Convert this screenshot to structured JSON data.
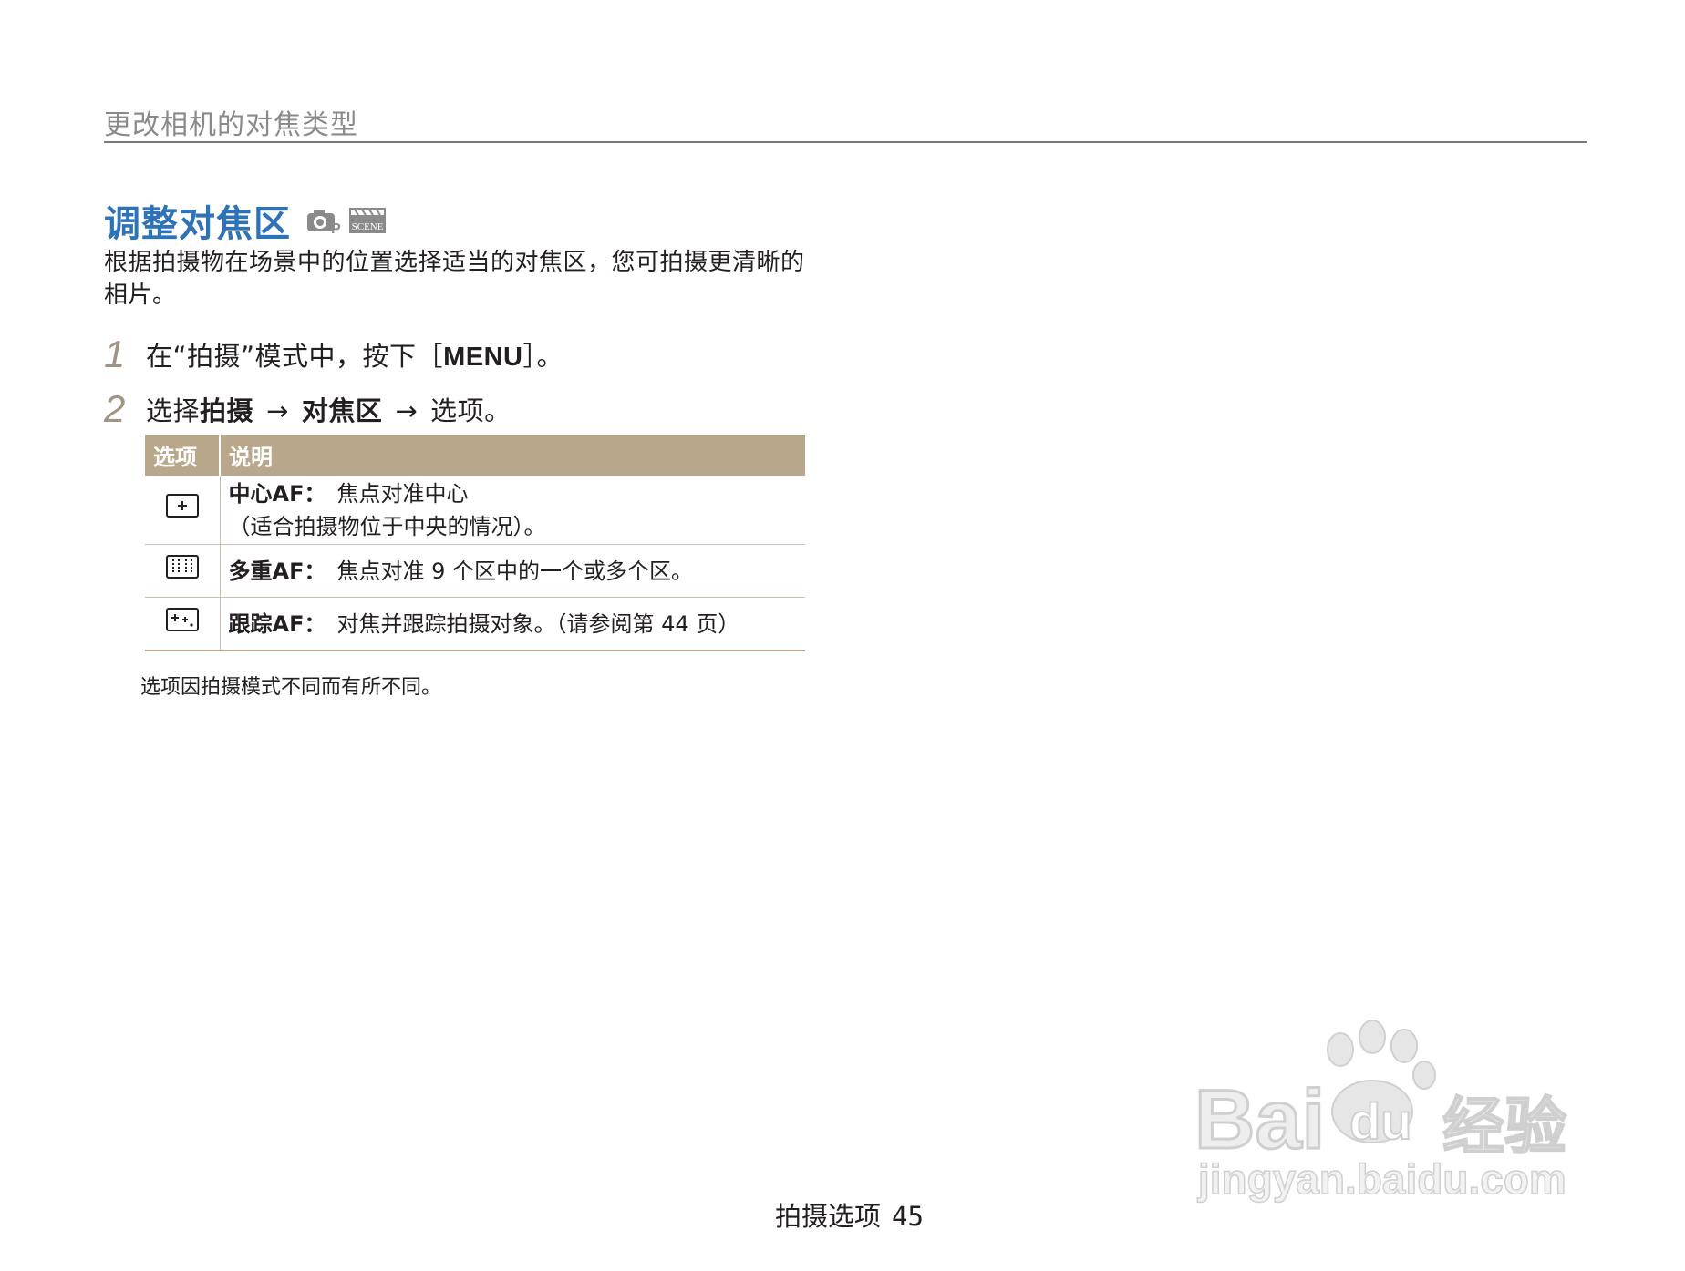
{
  "header": {
    "title": "更改相机的对焦类型"
  },
  "section": {
    "title": "调整对焦区",
    "mode_icons": [
      "camera-program-icon",
      "scene-mode-icon"
    ],
    "scene_icon_text": "SCENE",
    "program_icon_text": "P",
    "intro": "根据拍摄物在场景中的位置选择适当的对焦区，您可拍摄更清晰的相片。"
  },
  "steps": [
    {
      "number": "1",
      "text_before": "在“拍摄”模式中，按下［",
      "key": "MENU",
      "text_after": "］。"
    },
    {
      "number": "2",
      "prefix": "选择",
      "item1": "拍摄",
      "arrow1": "→",
      "item2": "对焦区",
      "arrow2": "→",
      "suffix": "选项。"
    }
  ],
  "table": {
    "headers": [
      "选项",
      "说明"
    ],
    "rows": [
      {
        "icon": "center-af-icon",
        "name": "中心AF：",
        "desc": "焦点对准中心",
        "desc2": "（适合拍摄物位于中央的情况）。"
      },
      {
        "icon": "multi-af-icon",
        "name": "多重AF：",
        "desc": "焦点对准 9 个区中的一个或多个区。"
      },
      {
        "icon": "tracking-af-icon",
        "name": "跟踪AF：",
        "desc": "对焦并跟踪拍摄对象。（请参阅第 44 页）"
      }
    ]
  },
  "note": "选项因拍摄模式不同而有所不同。",
  "footer": {
    "label": "拍摄选项",
    "page": "45"
  },
  "watermark": {
    "brand": "Bai",
    "brand2": "du",
    "cn": "经验",
    "url": "jingyan.baidu.com"
  },
  "colors": {
    "title_blue": "#2e73b8",
    "table_header": "#b9a78c",
    "step_number": "#a09485"
  }
}
